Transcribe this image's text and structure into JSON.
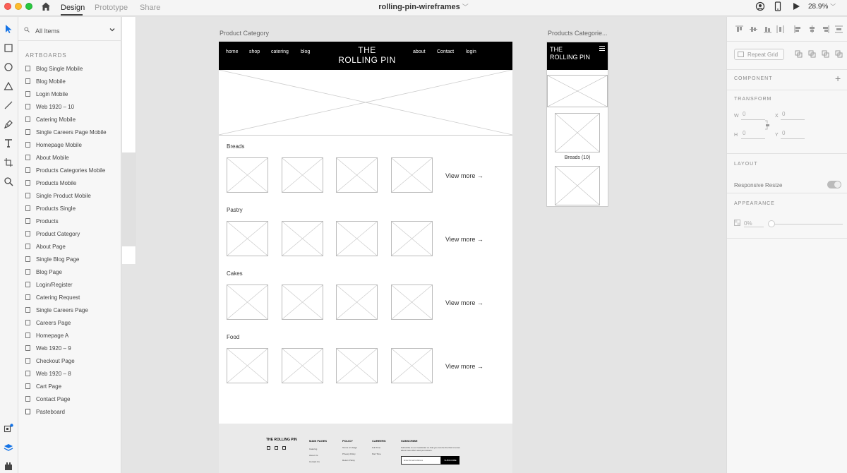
{
  "titlebar": {
    "tabs": [
      "Design",
      "Prototype",
      "Share"
    ],
    "document_title": "rolling-pin-wireframes",
    "zoom": "28.9%"
  },
  "tools": [
    "select-tool",
    "rectangle-tool",
    "ellipse-tool",
    "polygon-tool",
    "line-tool",
    "pen-tool",
    "text-tool",
    "artboard-tool",
    "zoom-tool"
  ],
  "layers": {
    "filter_label": "All Items",
    "section": "ARTBOARDS",
    "items": [
      "Blog Single Mobile",
      "Blog Mobile",
      "Login Mobile",
      "Web 1920 – 10",
      "Catering Mobile",
      "Single Careers Page Mobile",
      "Homepage Mobile",
      "About Mobile",
      "Products Categories Mobile",
      "Products Mobile",
      "Single Product Mobile",
      "Products Single",
      "Products",
      "Product Category",
      "About Page",
      "Single Blog Page",
      "Blog Page",
      "Login/Register",
      "Catering Request",
      "Single Careers Page",
      "Careers Page",
      "Homepage A",
      "Web 1920 – 9",
      "Checkout Page",
      "Web 1920 – 8",
      "Cart Page",
      "Contact Page",
      "Pasteboard"
    ]
  },
  "canvas": {
    "main_artboard": {
      "label": "Product Category",
      "nav_left": [
        "home",
        "shop",
        "catering",
        "blog"
      ],
      "nav_right": [
        "about",
        "Contact",
        "login"
      ],
      "logo_line1": "THE",
      "logo_line2": "ROLLING PIN",
      "categories": [
        "Breads",
        "Pastry",
        "Cakes",
        "Food"
      ],
      "view_more": "View more →",
      "footer": {
        "brand": "THE ROLLING PIN",
        "col1_title": "MAIN PAGES",
        "col1_links": [
          "Catering",
          "About Us",
          "Contact Us"
        ],
        "col2_title": "POLICY",
        "col2_links": [
          "Terms of Usage",
          "Privacy Policy",
          "Return Policy"
        ],
        "col3_title": "CAREERS",
        "col3_links": [
          "Full Time",
          "Part Time"
        ],
        "col4_title": "SUBSCRIBE",
        "subscribe_text": "Subscribe to our newsletter so that you can be the first to know about new offers and promotions.",
        "email_placeholder": "Enter Email Address",
        "subscribe_button": "SUBSCRIBE"
      }
    },
    "mobile_artboard": {
      "label": "Products Categorie...",
      "logo_line1": "THE",
      "logo_line2": "ROLLING PIN",
      "caption": "Breads (10)"
    }
  },
  "inspector": {
    "repeat_grid": "Repeat Grid",
    "component": "COMPONENT",
    "transform": "TRANSFORM",
    "w_label": "W",
    "w_value": "0",
    "x_label": "X",
    "x_value": "0",
    "h_label": "H",
    "h_value": "0",
    "y_label": "Y",
    "y_value": "0",
    "layout": "LAYOUT",
    "responsive_resize": "Responsive Resize",
    "appearance": "APPEARANCE",
    "opacity": "0%"
  },
  "colors": {
    "accent": "#1473e6",
    "nav_black": "#000000",
    "panel_bg": "#f7f7f7",
    "canvas_bg": "#e4e4e4"
  }
}
